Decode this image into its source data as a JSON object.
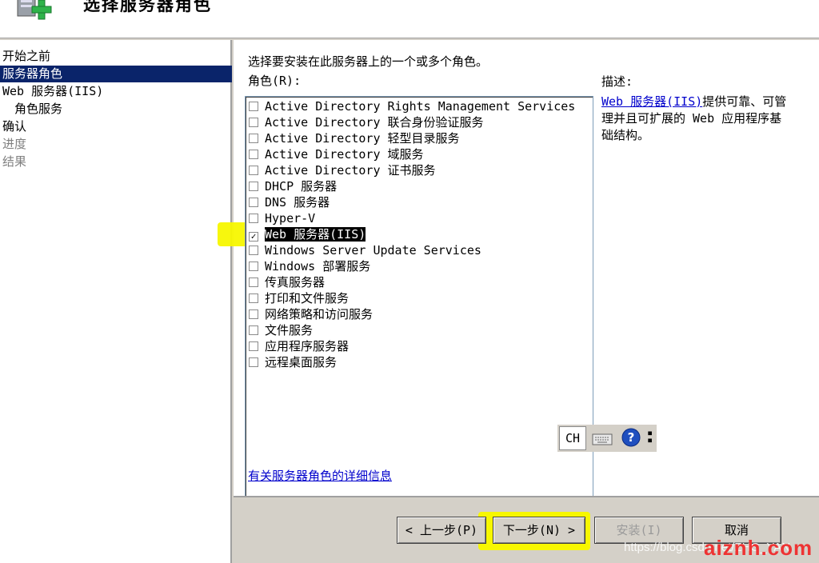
{
  "header": {
    "title": "选择服务器角色",
    "icon": "server-roles-icon"
  },
  "sidebar": {
    "items": [
      {
        "label": "开始之前",
        "state": "normal"
      },
      {
        "label": "服务器角色",
        "state": "selected"
      },
      {
        "label": "Web 服务器(IIS)",
        "state": "normal"
      },
      {
        "label": "角色服务",
        "state": "sub"
      },
      {
        "label": "确认",
        "state": "normal"
      },
      {
        "label": "进度",
        "state": "disabled"
      },
      {
        "label": "结果",
        "state": "disabled"
      }
    ]
  },
  "main": {
    "instruction": "选择要安装在此服务器上的一个或多个角色。",
    "roles_label": "角色(R):",
    "roles": [
      {
        "label": "Active Directory Rights Management Services",
        "checked": false
      },
      {
        "label": "Active Directory 联合身份验证服务",
        "checked": false
      },
      {
        "label": "Active Directory 轻型目录服务",
        "checked": false
      },
      {
        "label": "Active Directory 域服务",
        "checked": false
      },
      {
        "label": "Active Directory 证书服务",
        "checked": false
      },
      {
        "label": "DHCP 服务器",
        "checked": false
      },
      {
        "label": "DNS 服务器",
        "checked": false
      },
      {
        "label": "Hyper-V",
        "checked": false
      },
      {
        "label": "Web 服务器(IIS)",
        "checked": true
      },
      {
        "label": "Windows Server Update Services",
        "checked": false
      },
      {
        "label": "Windows 部署服务",
        "checked": false
      },
      {
        "label": "传真服务器",
        "checked": false
      },
      {
        "label": "打印和文件服务",
        "checked": false
      },
      {
        "label": "网络策略和访问服务",
        "checked": false
      },
      {
        "label": "文件服务",
        "checked": false
      },
      {
        "label": "应用程序服务器",
        "checked": false
      },
      {
        "label": "远程桌面服务",
        "checked": false
      }
    ],
    "description_label": "描述:",
    "description_link": "Web 服务器(IIS)",
    "description_text": "提供可靠、可管理并且可扩展的 Web 应用程序基础结构。",
    "more_info_link": "有关服务器角色的详细信息"
  },
  "language_bar": {
    "lang": "CH",
    "keyboard_icon": "keyboard-icon",
    "help_icon": "help-icon"
  },
  "footer": {
    "prev_label": "< 上一步(P)",
    "next_label": "下一步(N) >",
    "install_label": "安装(I)",
    "cancel_label": "取消"
  },
  "watermark": {
    "url": "https://blog.csdn.net/ZHG_YAN",
    "brand": "aiznh.com"
  },
  "colors": {
    "selection": "#0a246a",
    "highlight": "#f7f700",
    "link": "#0000cc",
    "face": "#d4d0c8"
  }
}
